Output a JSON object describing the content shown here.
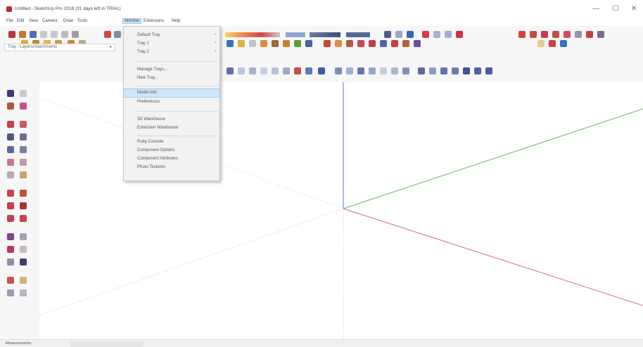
{
  "window": {
    "title": "Untitled - SketchUp Pro 2018 (31 days left in TRIAL)",
    "minimize_glyph": "—",
    "maximize_glyph": "☐",
    "close_glyph": "✕"
  },
  "menubar": {
    "items": [
      {
        "label": "File"
      },
      {
        "label": "Edit"
      },
      {
        "label": "View"
      },
      {
        "label": "Camera"
      },
      {
        "label": "Draw"
      },
      {
        "label": "Tools"
      },
      {
        "label": "Window"
      },
      {
        "label": "Extensions"
      },
      {
        "label": "Help"
      }
    ]
  },
  "scene_select": {
    "value": "Tray - Layers/Attachments",
    "arrow": "▾"
  },
  "window_menu": {
    "items": [
      {
        "label": "Default Tray",
        "submenu": true
      },
      {
        "label": "Tray 1",
        "submenu": true
      },
      {
        "label": "Tray 2",
        "submenu": true
      },
      {
        "label": "Manage Trays..."
      },
      {
        "label": "New Tray..."
      },
      {
        "label": "Model Info",
        "highlighted": true
      },
      {
        "label": "Preferences"
      },
      {
        "label": "3D Warehouse"
      },
      {
        "label": "Extension Warehouse"
      },
      {
        "label": "Ruby Console"
      },
      {
        "label": "Component Options"
      },
      {
        "label": "Component Attributes"
      },
      {
        "label": "Photo Textures"
      }
    ],
    "submenu_arrow": "›"
  },
  "statusbar": {
    "tabs": [
      {
        "label": "Measurements"
      },
      {
        "label": ""
      }
    ]
  },
  "colors": {
    "axis_red": "#d35b6a",
    "axis_green": "#3fb04a",
    "axis_blue": "#5b5bd6",
    "highlight": "#cde6fa",
    "app_red": "#c62828"
  }
}
